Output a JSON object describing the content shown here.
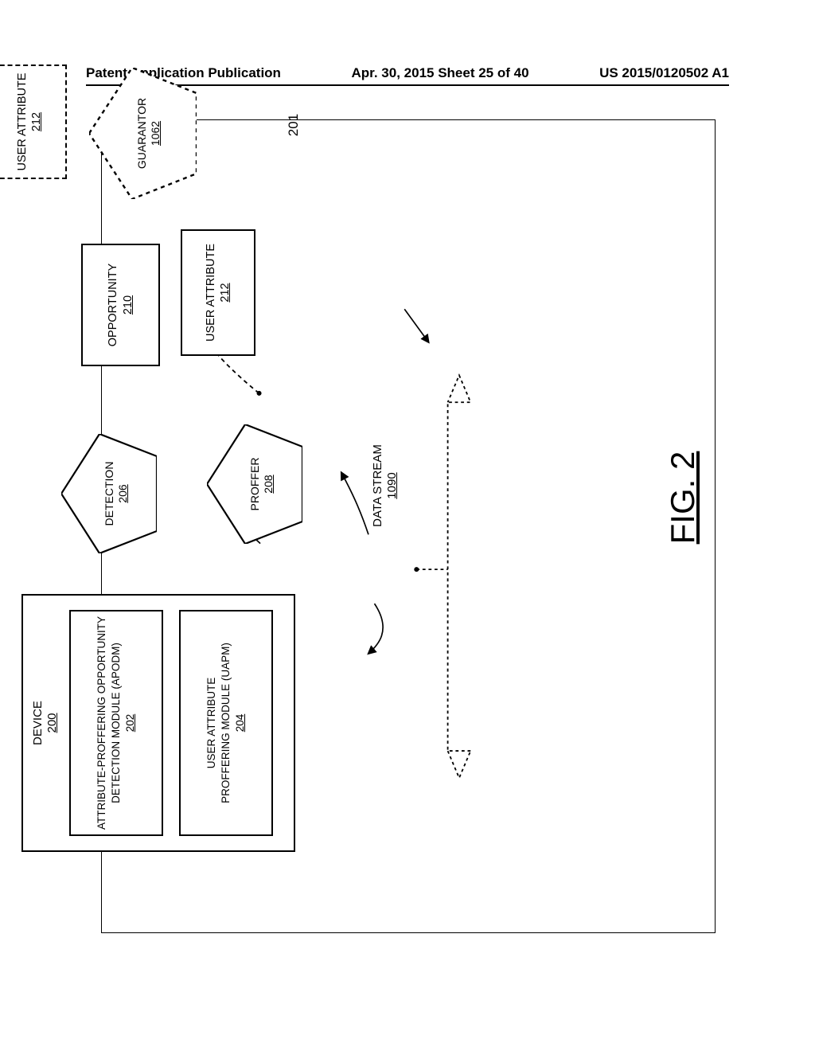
{
  "header": {
    "left": "Patent Application Publication",
    "mid": "Apr. 30, 2015  Sheet 25 of 40",
    "right": "US 2015/0120502 A1"
  },
  "device": {
    "title": "DEVICE",
    "num": "200"
  },
  "apodm": {
    "line1": "ATTRIBUTE-PROFFERING OPPORTUNITY",
    "line2": "DETECTION MODULE (APODM)",
    "num": "202"
  },
  "uapm": {
    "line1": "USER ATTRIBUTE",
    "line2": "PROFFERING MODULE (UAPM)",
    "num": "204"
  },
  "detection": {
    "label": "DETECTION",
    "num": "206"
  },
  "proffer": {
    "label": "PROFFER",
    "num": "208"
  },
  "opportunity": {
    "label": "OPPORTUNITY",
    "num": "210"
  },
  "userattr": {
    "label": "USER ATTRIBUTE",
    "num": "212"
  },
  "userattr2": {
    "label": "USER ATTRIBUTE",
    "num": "212"
  },
  "guarantor": {
    "label": "GUARANTOR",
    "num": "1062"
  },
  "datastream": {
    "label": "DATA STREAM",
    "num": "1090"
  },
  "fig": "FIG. 2",
  "ref201": "201"
}
